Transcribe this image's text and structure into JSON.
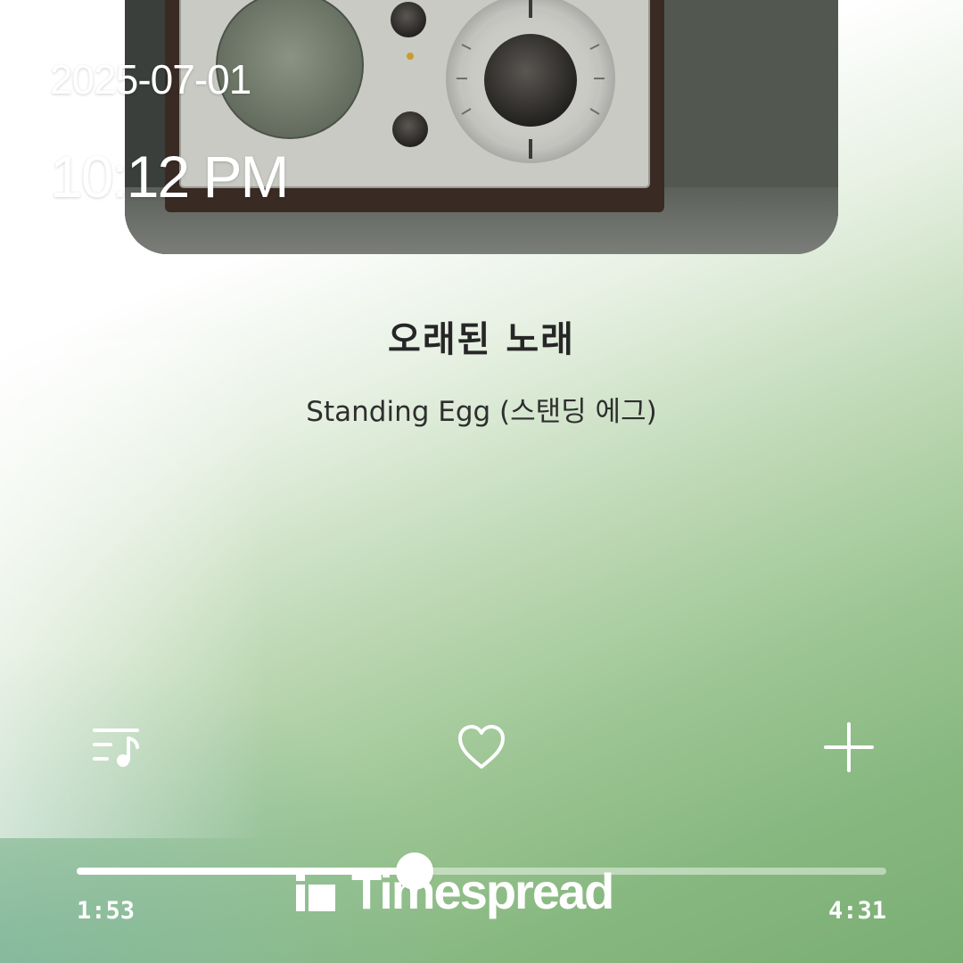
{
  "status": {
    "date": "2025-07-01",
    "time": "10:12 PM"
  },
  "song": {
    "title": "오래된 노래",
    "artist": "Standing Egg (스탠딩 에그)"
  },
  "actions": {
    "playlist_icon": "playlist-music-icon",
    "like_icon": "heart-outline-icon",
    "add_icon": "plus-icon"
  },
  "progress": {
    "elapsed": "1:53",
    "total": "4:31",
    "fraction": 0.417
  },
  "watermark": {
    "text": "Timespread"
  },
  "colors": {
    "gradient_green": "#7aae74",
    "icon": "#ffffff",
    "title_text": "#262626"
  }
}
